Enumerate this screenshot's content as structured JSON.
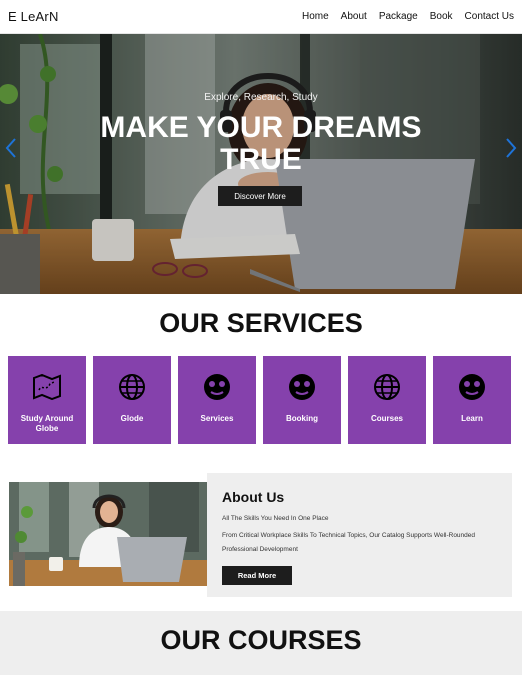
{
  "nav": {
    "logo": "E LeArN",
    "links": [
      "Home",
      "About",
      "Package",
      "Book",
      "Contact Us"
    ]
  },
  "hero": {
    "tagline": "Explore, Research, Study",
    "title_line1": "MAKE YOUR DREAMS",
    "title_line2": "TRUE",
    "button": "Discover More"
  },
  "services": {
    "title": "OUR SERVICES",
    "cards": [
      {
        "label": "Study Around Globe",
        "icon": "map-icon"
      },
      {
        "label": "Glode",
        "icon": "globe-icon"
      },
      {
        "label": "Services",
        "icon": "hiker-icon"
      },
      {
        "label": "Booking",
        "icon": "hiker-icon"
      },
      {
        "label": "Courses",
        "icon": "globe-icon"
      },
      {
        "label": "Learn",
        "icon": "hiker-icon"
      }
    ],
    "card_color": "#8541ac"
  },
  "about": {
    "title": "About Us",
    "line1": "All The Skills You Need In One Place",
    "line2": "From Critical Workplace Skills To Technical Topics, Our Catalog Supports Well-Rounded Professional Development",
    "button": "Read More"
  },
  "courses": {
    "title": "OUR COURSES"
  },
  "colors": {
    "accent": "#8541ac",
    "button": "#1d1d1d",
    "panel": "#eeeeee",
    "arrow": "#1e73d8"
  }
}
